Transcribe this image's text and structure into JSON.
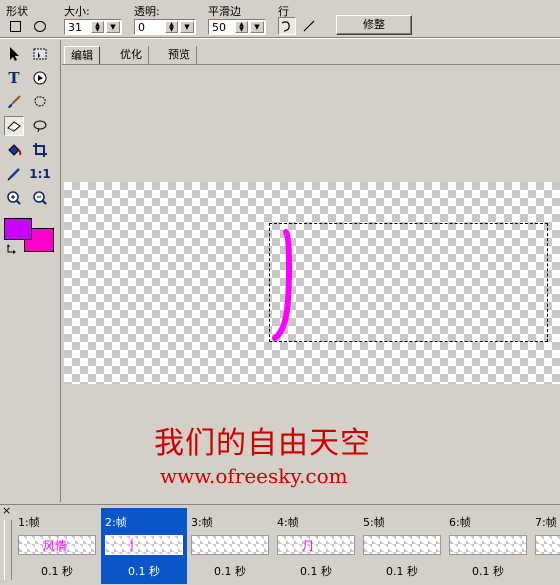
{
  "toolbar": {
    "shape_label": "形状",
    "size_label": "大小:",
    "size_value": "31",
    "opacity_label": "透明:",
    "opacity_value": "0",
    "smooth_label": "平滑边",
    "smooth_value": "50",
    "line_label": "行",
    "trim_button": "修整"
  },
  "tools": {
    "actual_size_label": "1:1"
  },
  "tabs": [
    {
      "label": "编辑",
      "active": true
    },
    {
      "label": "优化",
      "active": false
    },
    {
      "label": "预览",
      "active": false
    }
  ],
  "canvas": {
    "watermark_title": "我们的自由天空",
    "watermark_url": "www.ofreesky.com",
    "stroke_color": "#ff00ff"
  },
  "colors": {
    "foreground": "#cc00ff",
    "background": "#ff00cc"
  },
  "timeline": {
    "close_label": "×",
    "frames": [
      {
        "label": "1:帧",
        "thumb_text": "风情",
        "duration": "0.1 秒",
        "selected": false
      },
      {
        "label": "2:帧",
        "thumb_text": "|",
        "duration": "0.1 秒",
        "selected": true
      },
      {
        "label": "3:帧",
        "thumb_text": "",
        "duration": "0.1 秒",
        "selected": false
      },
      {
        "label": "4:帧",
        "thumb_text": "⺆",
        "duration": "0.1 秒",
        "selected": false
      },
      {
        "label": "5:帧",
        "thumb_text": "",
        "duration": "0.1 秒",
        "selected": false
      },
      {
        "label": "6:帧",
        "thumb_text": "",
        "duration": "0.1 秒",
        "selected": false
      },
      {
        "label": "7:帧",
        "thumb_text": "",
        "duration": "",
        "selected": false
      }
    ]
  }
}
